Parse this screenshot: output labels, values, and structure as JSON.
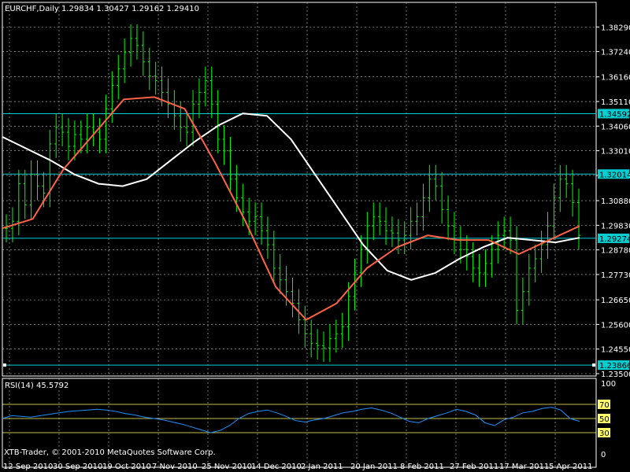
{
  "header": {
    "symbol": "EURCHF,Daily",
    "ohlc": "1.29834 1.30427 1.29162 1.29410"
  },
  "watermark": "XTB-Trader, © 2001-2010 MetaQuotes Software Corp.",
  "colors": {
    "background": "#000000",
    "grid": "#c0c0c0",
    "bull_bar": "#00ff00",
    "ma_fast": "#ff6347",
    "ma_slow": "#ffffff",
    "hline": "#00ced1",
    "rsi_line": "#1e90ff",
    "rsi_level": "#ffff66"
  },
  "chart_data": [
    {
      "type": "candlestick",
      "title": "EURCHF,Daily",
      "ylim": [
        1.235,
        1.385
      ],
      "y_ticks": [
        "1.38290",
        "1.37240",
        "1.36160",
        "1.35110",
        "1.34060",
        "1.33010",
        "1.31960",
        "1.30880",
        "1.29830",
        "1.28780",
        "1.27730",
        "1.26650",
        "1.25600",
        "1.24550",
        "1.23500"
      ],
      "x_ticks": [
        "12 Sep 2010",
        "30 Sep 2010",
        "19 Oct 2010",
        "7 Nov 2010",
        "25 Nov 2010",
        "14 Dec 2010",
        "2 Jan 2011",
        "20 Jan 2011",
        "8 Feb 2011",
        "27 Feb 2011",
        "17 Mar 2011",
        "5 Apr 2011"
      ],
      "price_lines": [
        {
          "value": 1.34592,
          "label": "1.34592"
        },
        {
          "value": 1.32014,
          "label": "1.32014"
        },
        {
          "value": 1.29274,
          "label": "1.29274"
        },
        {
          "value": 1.23866,
          "label": "1.23866"
        }
      ],
      "close_series": [
        1.297,
        1.3,
        1.316,
        1.307,
        1.32,
        1.315,
        1.312,
        1.333,
        1.34,
        1.338,
        1.332,
        1.337,
        1.335,
        1.34,
        1.338,
        1.335,
        1.348,
        1.358,
        1.365,
        1.372,
        1.378,
        1.375,
        1.368,
        1.362,
        1.36,
        1.355,
        1.35,
        1.345,
        1.34,
        1.338,
        1.35,
        1.355,
        1.36,
        1.35,
        1.335,
        1.33,
        1.318,
        1.31,
        1.304,
        1.3,
        1.302,
        1.296,
        1.29,
        1.28,
        1.275,
        1.27,
        1.265,
        1.258,
        1.252,
        1.248,
        1.247,
        1.246,
        1.25,
        1.252,
        1.255,
        1.268,
        1.278,
        1.288,
        1.298,
        1.302,
        1.3,
        1.296,
        1.295,
        1.292,
        1.294,
        1.3,
        1.302,
        1.31,
        1.318,
        1.315,
        1.305,
        1.298,
        1.292,
        1.288,
        1.285,
        1.28,
        1.278,
        1.282,
        1.288,
        1.294,
        1.296,
        1.292,
        1.262,
        1.27,
        1.28,
        1.284,
        1.29,
        1.298,
        1.31,
        1.318,
        1.316,
        1.308,
        1.294
      ],
      "ma_slow": [
        1.336,
        1.331,
        1.326,
        1.32,
        1.316,
        1.315,
        1.318,
        1.326,
        1.334,
        1.341,
        1.346,
        1.345,
        1.335,
        1.32,
        1.305,
        1.29,
        1.279,
        1.275,
        1.278,
        1.284,
        1.289,
        1.293,
        1.292,
        1.291,
        1.293
      ],
      "ma_fast": [
        1.297,
        1.301,
        1.322,
        1.337,
        1.352,
        1.353,
        1.348,
        1.325,
        1.3,
        1.272,
        1.258,
        1.265,
        1.28,
        1.289,
        1.294,
        1.292,
        1.292,
        1.286,
        1.292,
        1.298
      ],
      "ma_fast_labels": [
        "12 Sep 2010",
        "30 Sep 2010",
        "19 Oct 2010",
        "7 Nov 2010",
        "25 Nov 2010",
        "14 Dec 2010",
        "2 Jan 2011",
        "20 Jan 2011",
        "8 Feb 2011",
        "27 Feb 2011",
        "17 Mar 2011",
        "5 Apr 2011"
      ]
    },
    {
      "type": "line",
      "title": "RSI(14) 45.5792",
      "ylim": [
        0,
        100
      ],
      "y_ticks": [
        "100",
        "70",
        "50",
        "30",
        "0"
      ],
      "levels": [
        70,
        50,
        30
      ],
      "values": [
        50,
        54,
        53,
        52,
        54,
        56,
        58,
        60,
        61,
        62,
        63,
        62,
        60,
        57,
        55,
        52,
        50,
        48,
        45,
        42,
        38,
        34,
        30,
        33,
        40,
        50,
        57,
        60,
        62,
        58,
        53,
        47,
        45,
        48,
        50,
        54,
        58,
        60,
        63,
        65,
        62,
        58,
        52,
        46,
        44,
        50,
        54,
        58,
        63,
        60,
        55,
        44,
        40,
        48,
        52,
        58,
        60,
        64,
        66,
        62,
        50,
        46
      ]
    }
  ]
}
